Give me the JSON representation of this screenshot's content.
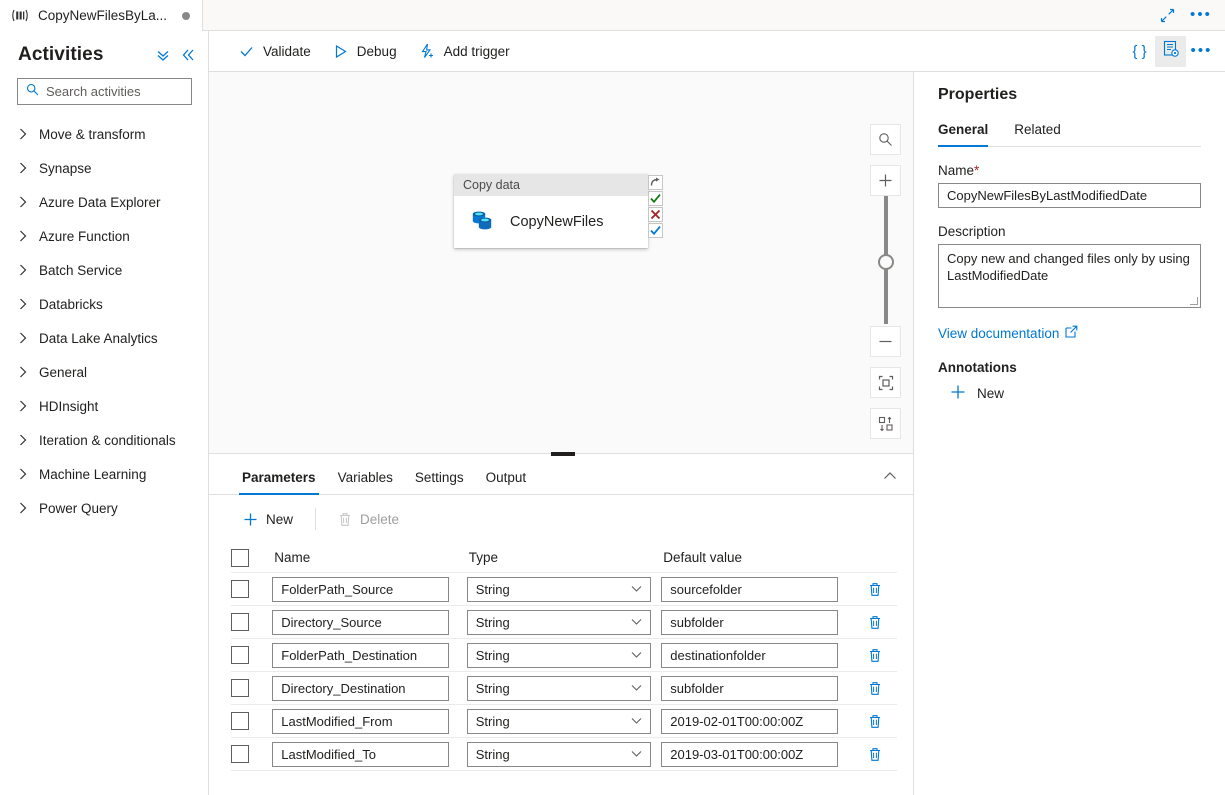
{
  "tab": {
    "icon": "pipeline-icon",
    "label": "CopyNewFilesByLa...",
    "dirty_dot": "unsaved-indicator"
  },
  "window_controls": {
    "expand_label": "expand-icon",
    "more_label": "•••"
  },
  "activities_pane": {
    "title": "Activities",
    "collapse_all_icon": "double-chevron-down-icon",
    "collapse_pane_icon": "double-chevron-left-icon",
    "search": {
      "placeholder": "Search activities",
      "value": "",
      "icon": "search-icon"
    },
    "items": [
      {
        "label": "Move & transform"
      },
      {
        "label": "Synapse"
      },
      {
        "label": "Azure Data Explorer"
      },
      {
        "label": "Azure Function"
      },
      {
        "label": "Batch Service"
      },
      {
        "label": "Databricks"
      },
      {
        "label": "Data Lake Analytics"
      },
      {
        "label": "General"
      },
      {
        "label": "HDInsight"
      },
      {
        "label": "Iteration & conditionals"
      },
      {
        "label": "Machine Learning"
      },
      {
        "label": "Power Query"
      }
    ]
  },
  "toolbar": {
    "validate_label": "Validate",
    "debug_label": "Debug",
    "add_trigger_label": "Add trigger",
    "code_icon": "{ }",
    "properties_icon": "properties-panel-icon",
    "more_icon": "•••"
  },
  "canvas": {
    "node": {
      "header": "Copy data",
      "name": "CopyNewFiles",
      "icon": "copy-data-icon",
      "handles": [
        {
          "name": "skip-handle",
          "glyph": "↷",
          "color": "#605e5c"
        },
        {
          "name": "success-handle",
          "glyph": "✔",
          "color": "#107c10"
        },
        {
          "name": "failure-handle",
          "glyph": "✖",
          "color": "#a4262c"
        },
        {
          "name": "completion-handle",
          "glyph": "✔",
          "color": "#0078d4"
        }
      ]
    },
    "zoom_controls": {
      "search_icon": "magnifier-icon",
      "zoom_in_icon": "+",
      "zoom_out_icon": "−",
      "fit_icon": "fit-to-screen-icon",
      "align_icon": "auto-align-icon"
    }
  },
  "bottom_panel": {
    "tabs": [
      {
        "label": "Parameters",
        "active": true
      },
      {
        "label": "Variables",
        "active": false
      },
      {
        "label": "Settings",
        "active": false
      },
      {
        "label": "Output",
        "active": false
      }
    ],
    "collapse_icon": "chevron-up-icon",
    "commands": {
      "new_label": "New",
      "delete_label": "Delete",
      "delete_disabled": true
    },
    "table": {
      "columns": [
        "Name",
        "Type",
        "Default value"
      ],
      "rows": [
        {
          "name": "FolderPath_Source",
          "type": "String",
          "default": "sourcefolder"
        },
        {
          "name": "Directory_Source",
          "type": "String",
          "default": "subfolder"
        },
        {
          "name": "FolderPath_Destination",
          "type": "String",
          "default": "destinationfolder"
        },
        {
          "name": "Directory_Destination",
          "type": "String",
          "default": "subfolder"
        },
        {
          "name": "LastModified_From",
          "type": "String",
          "default": "2019-02-01T00:00:00Z"
        },
        {
          "name": "LastModified_To",
          "type": "String",
          "default": "2019-03-01T00:00:00Z"
        }
      ]
    }
  },
  "properties": {
    "title": "Properties",
    "tabs": [
      {
        "label": "General",
        "active": true
      },
      {
        "label": "Related",
        "active": false
      }
    ],
    "name_label": "Name",
    "name_required": "*",
    "name_value": "CopyNewFilesByLastModifiedDate",
    "description_label": "Description",
    "description_value": "Copy new and changed files only by using LastModifiedDate",
    "documentation_link": "View documentation",
    "documentation_icon": "external-link-icon",
    "annotations_title": "Annotations",
    "annotations_new": "New"
  },
  "colors": {
    "accent": "#0078d4",
    "success": "#107c10",
    "error": "#a4262c",
    "canvas_bg": "#fafafa",
    "border": "#e1dfdd"
  }
}
